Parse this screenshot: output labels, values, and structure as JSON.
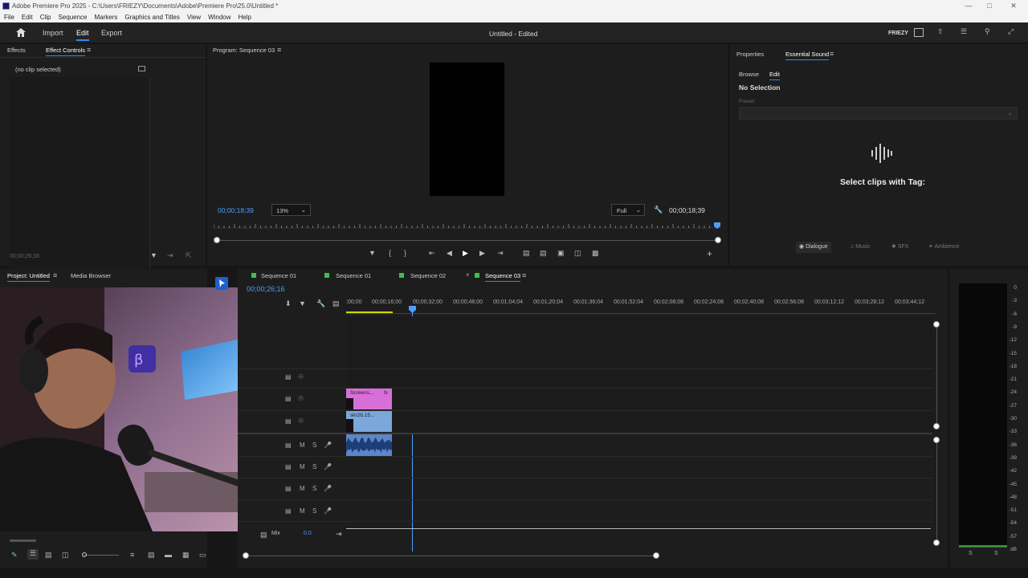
{
  "window": {
    "title": "Adobe Premiere Pro 2025 - C:\\Users\\FRIEZY\\Documents\\Adobe\\Premiere Pro\\25.0\\Untitled *"
  },
  "menu": [
    "File",
    "Edit",
    "Clip",
    "Sequence",
    "Markers",
    "Graphics and Titles",
    "View",
    "Window",
    "Help"
  ],
  "header": {
    "import": "Import",
    "edit": "Edit",
    "export": "Export",
    "doc_title": "Untitled",
    "doc_status": "- Edited",
    "user": "FRIEZY"
  },
  "effects": {
    "tab_effects": "Effects",
    "tab_controls": "Effect Controls",
    "no_clip": "(no clip selected)",
    "timecode": "00;00;26;16"
  },
  "program": {
    "tab": "Program: Sequence 03",
    "timecode_left": "00;00;18;39",
    "zoom": "13%",
    "quality": "Full",
    "timecode_right": "00;00;18;39"
  },
  "essential": {
    "tab_properties": "Properties",
    "tab_essential": "Essential Sound",
    "sub_browse": "Browse",
    "sub_edit": "Edit",
    "no_selection": "No Selection",
    "preset_label": "Preset:",
    "select_clips": "Select clips with Tag:",
    "tags": [
      "Dialogue",
      "Music",
      "SFX",
      "Ambience"
    ]
  },
  "project": {
    "tab_project": "Project: Untitled",
    "tab_media": "Media Browser"
  },
  "timeline": {
    "tabs": [
      "Sequence 01",
      "Sequence 01",
      "Sequence 02",
      "Sequence 03"
    ],
    "timecode": "00;00;26;16",
    "ruler": [
      ":00;00",
      "00;00;16;00",
      "00;00;32;00",
      "00;00;48;00",
      "00;01;04;04",
      "00;01;20;04",
      "00;01;36;04",
      "00;01;52;04",
      "00;02;08;08",
      "00;02;24;08",
      "00;02;40;08",
      "00;02;56;08",
      "00;03;12;12",
      "00;03;28;12",
      "00;03;44;12"
    ],
    "clip_v2": "Screens...",
    "clip_v2_fx": "fx",
    "clip_v1": "skr26.15...",
    "mix_label": "Mix",
    "mix_value": "0.0",
    "track_m": "M",
    "track_s": "S"
  },
  "meter": {
    "scale": [
      "0",
      "-3",
      "-6",
      "-9",
      "-12",
      "-15",
      "-18",
      "-21",
      "-24",
      "-27",
      "-30",
      "-33",
      "-36",
      "-39",
      "-42",
      "-45",
      "-48",
      "-51",
      "-54",
      "-57",
      "dB"
    ],
    "solo": [
      "S",
      "S"
    ]
  },
  "colors": {
    "accent": "#2d8ceb",
    "clip_pink": "#d86fd8",
    "clip_blue": "#7ba7db",
    "audio_blue": "#5b86c8",
    "playhead": "#4a9fff",
    "tab_green": "#3fbf4f"
  }
}
